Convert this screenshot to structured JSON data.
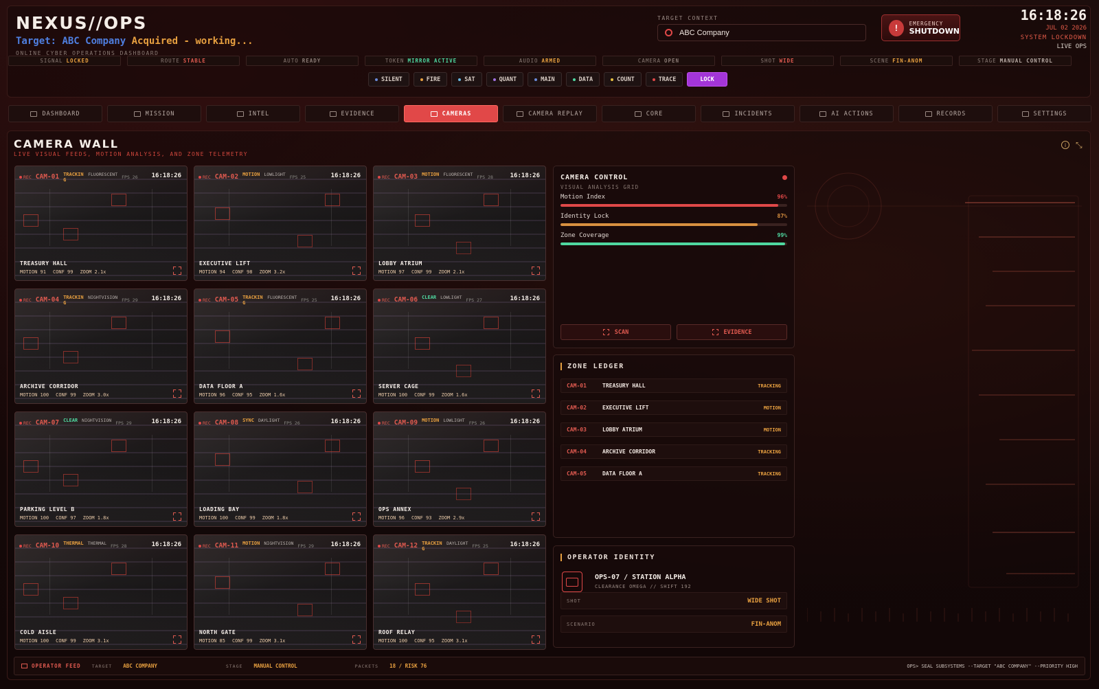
{
  "app": {
    "brand": "NEXUS//OPS",
    "target_prefix": "Target:",
    "target_name": "ABC Company",
    "target_status": "Acquired - working...",
    "subtitle": "ONLINE CYBER OPERATIONS DASHBOARD"
  },
  "context": {
    "label": "TARGET CONTEXT",
    "value": "ABC Company"
  },
  "shutdown": {
    "line1": "EMERGENCY",
    "line2": "SHUTDOWN"
  },
  "clock": {
    "time": "16:18:26",
    "date": "JUL 02 2026",
    "lockdown": "SYSTEM LOCKDOWN",
    "live": "LIVE OPS"
  },
  "status_chips": [
    {
      "label": "SIGNAL",
      "value": "LOCKED",
      "color": "#e8a040"
    },
    {
      "label": "ROUTE",
      "value": "STABLE",
      "color": "#e05a50"
    },
    {
      "label": "AUTO",
      "value": "READY",
      "color": "#8a7a74"
    },
    {
      "label": "TOKEN",
      "value": "MIRROR ACTIVE",
      "color": "#4fd8a0"
    },
    {
      "label": "AUDIO",
      "value": "ARMED",
      "color": "#e8a040"
    },
    {
      "label": "CAMERA",
      "value": "OPEN",
      "color": "#8a7a74"
    },
    {
      "label": "SHOT",
      "value": "WIDE",
      "color": "#e05a50"
    },
    {
      "label": "SCENE",
      "value": "FIN-ANOM",
      "color": "#e8a040"
    },
    {
      "label": "STAGE",
      "value": "MANUAL CONTROL",
      "color": "#b8aaa4"
    }
  ],
  "modes": [
    {
      "label": "SILENT",
      "dot": "#6a8ad8"
    },
    {
      "label": "FIRE",
      "dot": "#e8a040"
    },
    {
      "label": "SAT",
      "dot": "#6ab8e0"
    },
    {
      "label": "QUANT",
      "dot": "#a070e0"
    },
    {
      "label": "MAIN",
      "dot": "#6a8ad8"
    },
    {
      "label": "DATA",
      "dot": "#4fd8a0"
    },
    {
      "label": "COUNT",
      "dot": "#e8c040"
    },
    {
      "label": "TRACE",
      "dot": "#e04848"
    },
    {
      "label": "LOCK",
      "dot": ""
    }
  ],
  "nav": [
    {
      "label": "DASHBOARD",
      "icon": "dashboard-icon"
    },
    {
      "label": "MISSION",
      "icon": "crosshair-icon"
    },
    {
      "label": "INTEL",
      "icon": "id-card-icon"
    },
    {
      "label": "EVIDENCE",
      "icon": "network-icon"
    },
    {
      "label": "CAMERAS",
      "icon": "video-camera-icon"
    },
    {
      "label": "CAMERA REPLAY",
      "icon": "video-replay-icon"
    },
    {
      "label": "CORE",
      "icon": "signal-icon"
    },
    {
      "label": "INCIDENTS",
      "icon": "bell-icon"
    },
    {
      "label": "AI ACTIONS",
      "icon": "shield-icon"
    },
    {
      "label": "RECORDS",
      "icon": "folder-icon"
    },
    {
      "label": "SETTINGS",
      "icon": "sliders-icon"
    }
  ],
  "camera_wall": {
    "title": "CAMERA WALL",
    "subtitle": "LIVE VISUAL FEEDS, MOTION ANALYSIS, AND ZONE TELEMETRY"
  },
  "cameras": [
    {
      "id": "CAM-01",
      "status": "TRACKING",
      "status_color": "#e8a040",
      "light": "FLUORESCENT",
      "fps": "FPS 26",
      "time": "16:18:26",
      "name": "TREASURY HALL",
      "motion": "MOTION 91",
      "conf": "CONF 99",
      "zoom": "ZOOM 2.1x"
    },
    {
      "id": "CAM-02",
      "status": "MOTION",
      "status_color": "#e8a040",
      "light": "LOWLIGHT",
      "fps": "FPS 25",
      "time": "16:18:26",
      "name": "EXECUTIVE LIFT",
      "motion": "MOTION 94",
      "conf": "CONF 98",
      "zoom": "ZOOM 3.2x"
    },
    {
      "id": "CAM-03",
      "status": "MOTION",
      "status_color": "#e8a040",
      "light": "FLUORESCENT",
      "fps": "FPS 28",
      "time": "16:18:26",
      "name": "LOBBY ATRIUM",
      "motion": "MOTION 97",
      "conf": "CONF 99",
      "zoom": "ZOOM 2.1x"
    },
    {
      "id": "CAM-04",
      "status": "TRACKING",
      "status_color": "#e8a040",
      "light": "NIGHTVISION",
      "fps": "FPS 29",
      "time": "16:18:26",
      "name": "ARCHIVE CORRIDOR",
      "motion": "MOTION 100",
      "conf": "CONF 99",
      "zoom": "ZOOM 3.0x"
    },
    {
      "id": "CAM-05",
      "status": "TRACKING",
      "status_color": "#e8a040",
      "light": "FLUORESCENT",
      "fps": "FPS 25",
      "time": "16:18:26",
      "name": "DATA FLOOR A",
      "motion": "MOTION 96",
      "conf": "CONF 95",
      "zoom": "ZOOM 1.6x"
    },
    {
      "id": "CAM-06",
      "status": "CLEAR",
      "status_color": "#4fd8a0",
      "light": "LOWLIGHT",
      "fps": "FPS 27",
      "time": "16:18:26",
      "name": "SERVER CAGE",
      "motion": "MOTION 100",
      "conf": "CONF 99",
      "zoom": "ZOOM 1.6x"
    },
    {
      "id": "CAM-07",
      "status": "CLEAR",
      "status_color": "#4fd8a0",
      "light": "NIGHTVISION",
      "fps": "FPS 29",
      "time": "16:18:26",
      "name": "PARKING LEVEL B",
      "motion": "MOTION 100",
      "conf": "CONF 97",
      "zoom": "ZOOM 1.8x"
    },
    {
      "id": "CAM-08",
      "status": "SYNC",
      "status_color": "#e8a040",
      "light": "DAYLIGHT",
      "fps": "FPS 26",
      "time": "16:18:26",
      "name": "LOADING BAY",
      "motion": "MOTION 100",
      "conf": "CONF 99",
      "zoom": "ZOOM 1.8x"
    },
    {
      "id": "CAM-09",
      "status": "MOTION",
      "status_color": "#e8a040",
      "light": "LOWLIGHT",
      "fps": "FPS 26",
      "time": "16:18:26",
      "name": "OPS ANNEX",
      "motion": "MOTION 96",
      "conf": "CONF 93",
      "zoom": "ZOOM 2.9x"
    },
    {
      "id": "CAM-10",
      "status": "THERMAL",
      "status_color": "#e8a040",
      "light": "THERMAL",
      "fps": "FPS 28",
      "time": "16:18:26",
      "name": "COLD AISLE",
      "motion": "MOTION 100",
      "conf": "CONF 99",
      "zoom": "ZOOM 3.1x"
    },
    {
      "id": "CAM-11",
      "status": "MOTION",
      "status_color": "#e8a040",
      "light": "NIGHTVISION",
      "fps": "FPS 29",
      "time": "16:18:26",
      "name": "NORTH GATE",
      "motion": "MOTION 85",
      "conf": "CONF 99",
      "zoom": "ZOOM 3.1x"
    },
    {
      "id": "CAM-12",
      "status": "TRACKING",
      "status_color": "#e8a040",
      "light": "DAYLIGHT",
      "fps": "FPS 25",
      "time": "16:18:26",
      "name": "ROOF RELAY",
      "motion": "MOTION 100",
      "conf": "CONF 95",
      "zoom": "ZOOM 3.1x"
    }
  ],
  "camera_control": {
    "title": "CAMERA CONTROL",
    "subtitle": "VISUAL ANALYSIS GRID",
    "meters": [
      {
        "label": "Motion Index",
        "value": "96%",
        "fraction": 0.96,
        "color": "#e04848"
      },
      {
        "label": "Identity Lock",
        "value": "87%",
        "fraction": 0.87,
        "color": "#d89040"
      },
      {
        "label": "Zone Coverage",
        "value": "99%",
        "fraction": 0.99,
        "color": "#4fd8a0"
      }
    ],
    "scan_label": "SCAN",
    "evidence_label": "EVIDENCE"
  },
  "zone_ledger": {
    "title": "ZONE LEDGER",
    "rows": [
      {
        "id": "CAM-01",
        "name": "TREASURY HALL",
        "state": "TRACKING"
      },
      {
        "id": "CAM-02",
        "name": "EXECUTIVE LIFT",
        "state": "MOTION"
      },
      {
        "id": "CAM-03",
        "name": "LOBBY ATRIUM",
        "state": "MOTION"
      },
      {
        "id": "CAM-04",
        "name": "ARCHIVE CORRIDOR",
        "state": "TRACKING"
      },
      {
        "id": "CAM-05",
        "name": "DATA FLOOR A",
        "state": "TRACKING"
      }
    ]
  },
  "operator": {
    "title": "OPERATOR IDENTITY",
    "name": "OPS-07 / STATION ALPHA",
    "meta": "CLEARANCE OMEGA // SHIFT 192",
    "shot_label": "SHOT",
    "shot_value": "WIDE SHOT",
    "scenario_label": "SCENARIO",
    "scenario_value": "FIN-ANOM"
  },
  "footer": {
    "feed": "OPERATOR FEED",
    "target_k": "TARGET",
    "target_v": "ABC COMPANY",
    "stage_k": "STAGE",
    "stage_v": "MANUAL CONTROL",
    "packets_k": "PACKETS",
    "packets_v": "18 / RISK 76",
    "command": "OPS> SEAL SUBSYSTEMS --TARGET \"ABC COMPANY\" --PRIORITY HIGH"
  }
}
